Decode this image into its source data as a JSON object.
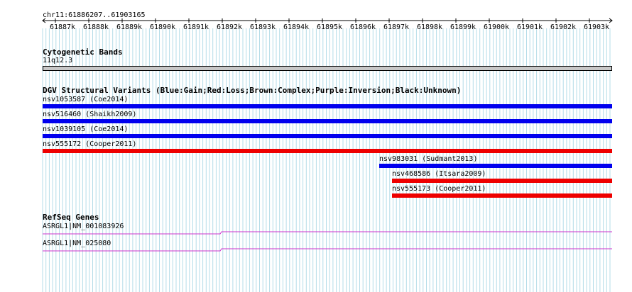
{
  "location": "chr11:61886207..61903165",
  "ruler": {
    "ticks": [
      "61887k",
      "61888k",
      "61889k",
      "61890k",
      "61891k",
      "61892k",
      "61893k",
      "61894k",
      "61895k",
      "61896k",
      "61897k",
      "61898k",
      "61899k",
      "61900k",
      "61901k",
      "61902k",
      "61903k"
    ]
  },
  "cytoband": {
    "header": "Cytogenetic Bands",
    "label": "11q12.3"
  },
  "dgv": {
    "header": "DGV Structural Variants (Blue:Gain;Red:Loss;Brown:Complex;Purple:Inversion;Black:Unknown)",
    "colors": {
      "gain": "#0000ee",
      "loss": "#ee0000"
    },
    "variants": [
      {
        "label": "nsv1053587 (Coe2014)",
        "type": "gain"
      },
      {
        "label": "nsv516460 (Shaikh2009)",
        "type": "gain"
      },
      {
        "label": "nsv1039105 (Coe2014)",
        "type": "gain"
      },
      {
        "label": "nsv555172 (Cooper2011)",
        "type": "loss"
      },
      {
        "label": "nsv983031 (Sudmant2013)",
        "type": "gain"
      },
      {
        "label": "nsv468586 (Itsara2009)",
        "type": "loss"
      },
      {
        "label": "nsv555173 (Cooper2011)",
        "type": "loss"
      }
    ]
  },
  "refseq": {
    "header": "RefSeq Genes",
    "color": "#cc33cc",
    "genes": [
      {
        "label": "ASRGL1|NM_001083926"
      },
      {
        "label": "ASRGL1|NM_025080"
      }
    ]
  }
}
